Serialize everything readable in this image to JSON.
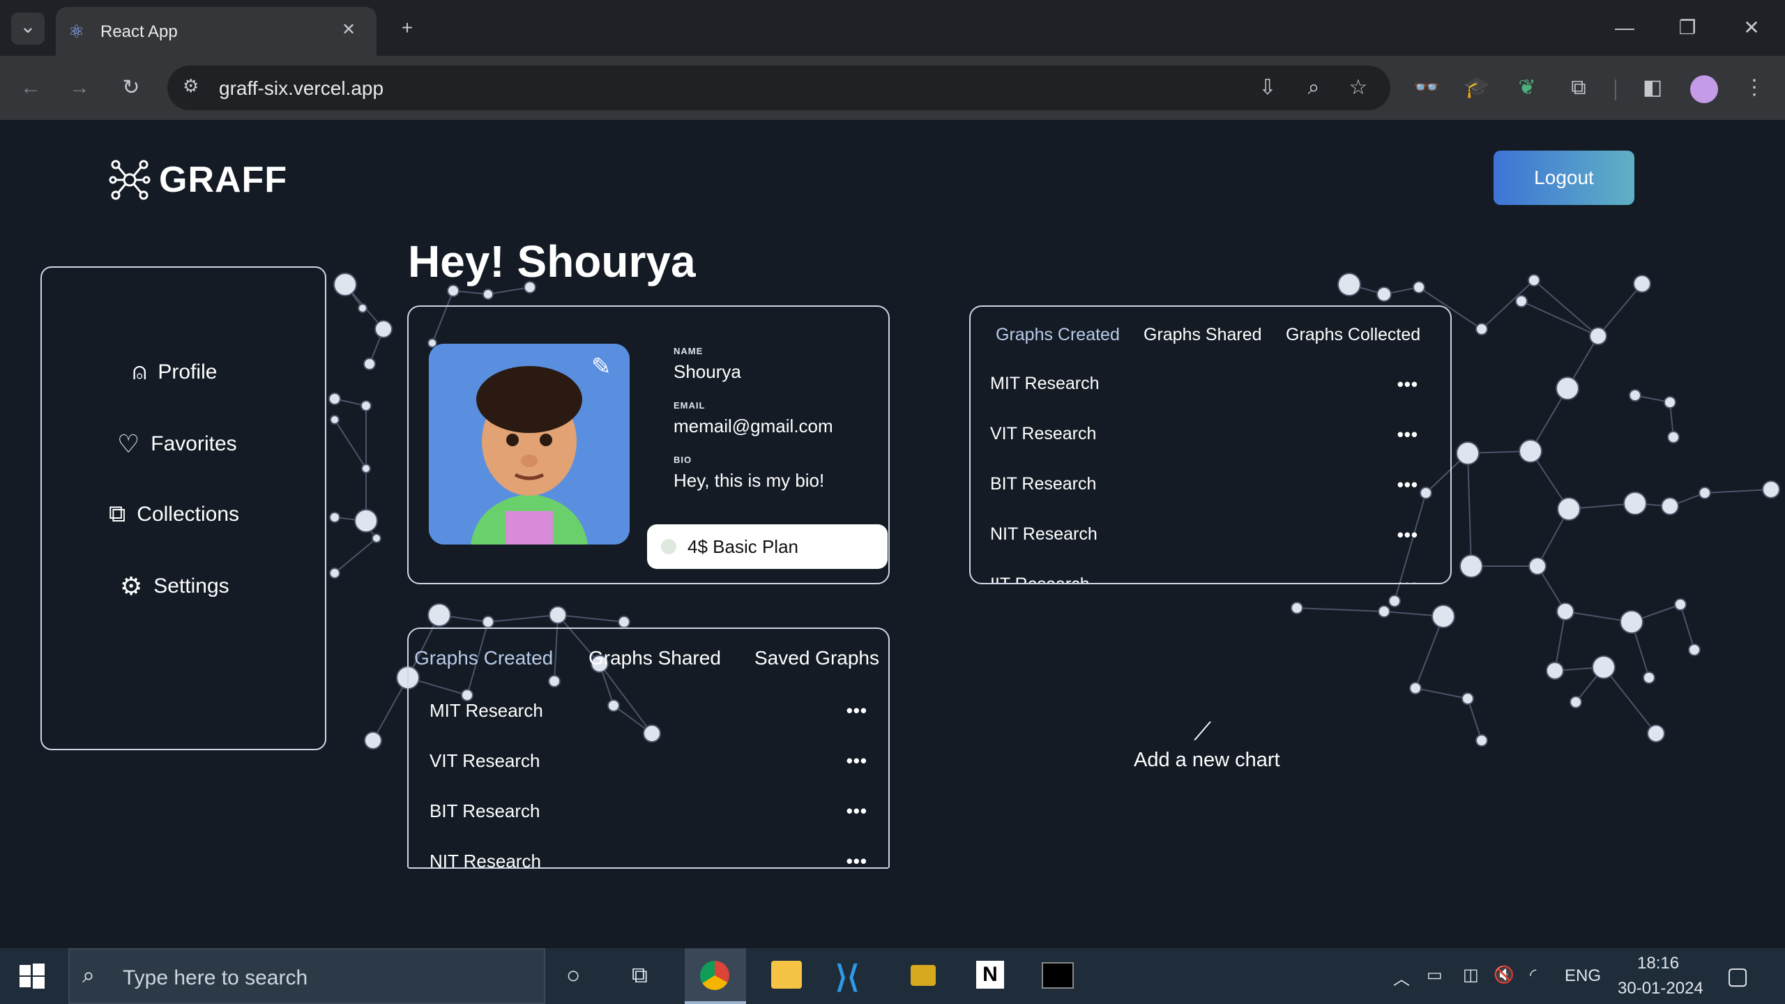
{
  "browser": {
    "tab_title": "React App",
    "new_tab": "+",
    "close_tab": "✕",
    "url": "graff-six.vercel.app",
    "window_controls": {
      "minimize": "—",
      "restore": "❐",
      "close": "✕"
    }
  },
  "app": {
    "logo": "GRAFF",
    "logout_label": "Logout",
    "greeting": "Hey! Shourya",
    "sidebar": {
      "items": [
        {
          "label": "Profile",
          "icon": "user-icon"
        },
        {
          "label": "Favorites",
          "icon": "heart-icon"
        },
        {
          "label": "Collections",
          "icon": "collections-icon"
        },
        {
          "label": "Settings",
          "icon": "gear-icon"
        }
      ]
    },
    "profile": {
      "name_label": "NAME",
      "name": "Shourya",
      "email_label": "EMAIL",
      "email": "memail@gmail.com",
      "bio_label": "BIO",
      "bio": "Hey, this is my bio!",
      "plan": "4$ Basic Plan"
    },
    "left_graphs": {
      "tabs": [
        "Graphs Created",
        "Graphs Shared",
        "Saved Graphs"
      ],
      "rows": [
        "MIT Research",
        "VIT Research",
        "BIT Research",
        "NIT Research"
      ],
      "more": "•••"
    },
    "right_graphs": {
      "tabs": [
        "Graphs Created",
        "Graphs Shared",
        "Graphs Collected"
      ],
      "rows": [
        "MIT Research",
        "VIT Research",
        "BIT Research",
        "NIT Research",
        "IIT Research"
      ],
      "more": "•••"
    },
    "add_chart_label": "Add a new chart",
    "colors": {
      "accent": "#3d74d6",
      "active_tab": "#b9cbea",
      "background": "#141b25"
    }
  },
  "taskbar": {
    "search_placeholder": "Type here to search",
    "language": "ENG",
    "time": "18:16",
    "date": "30-01-2024"
  }
}
